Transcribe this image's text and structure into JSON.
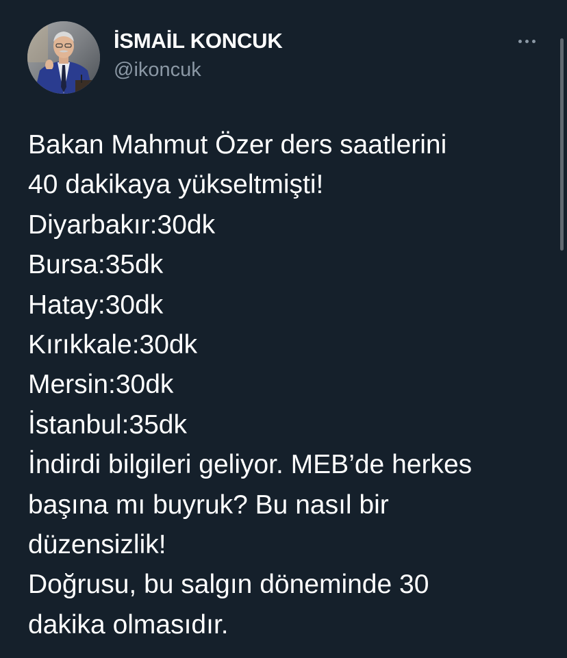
{
  "colors": {
    "background": "#15202b",
    "primary_text": "#ffffff",
    "secondary_text": "#8b98a5"
  },
  "author": {
    "display_name": "İSMAİL KONCUK",
    "handle": "@ikoncuk",
    "avatar_icon": "profile-photo"
  },
  "actions": {
    "more_icon": "more-horizontal-icon"
  },
  "tweet": {
    "lines": [
      "Bakan Mahmut Özer ders saatlerini",
      "40 dakikaya yükseltmişti!",
      "Diyarbakır:30dk",
      "Bursa:35dk",
      "Hatay:30dk",
      "Kırıkkale:30dk",
      "Mersin:30dk",
      "İstanbul:35dk",
      "İndirdi bilgileri geliyor. MEB’de herkes",
      "başına mı buyruk? Bu nasıl bir",
      "düzensizlik!",
      "Doğrusu, bu salgın döneminde 30",
      "dakika olmasıdır."
    ]
  }
}
